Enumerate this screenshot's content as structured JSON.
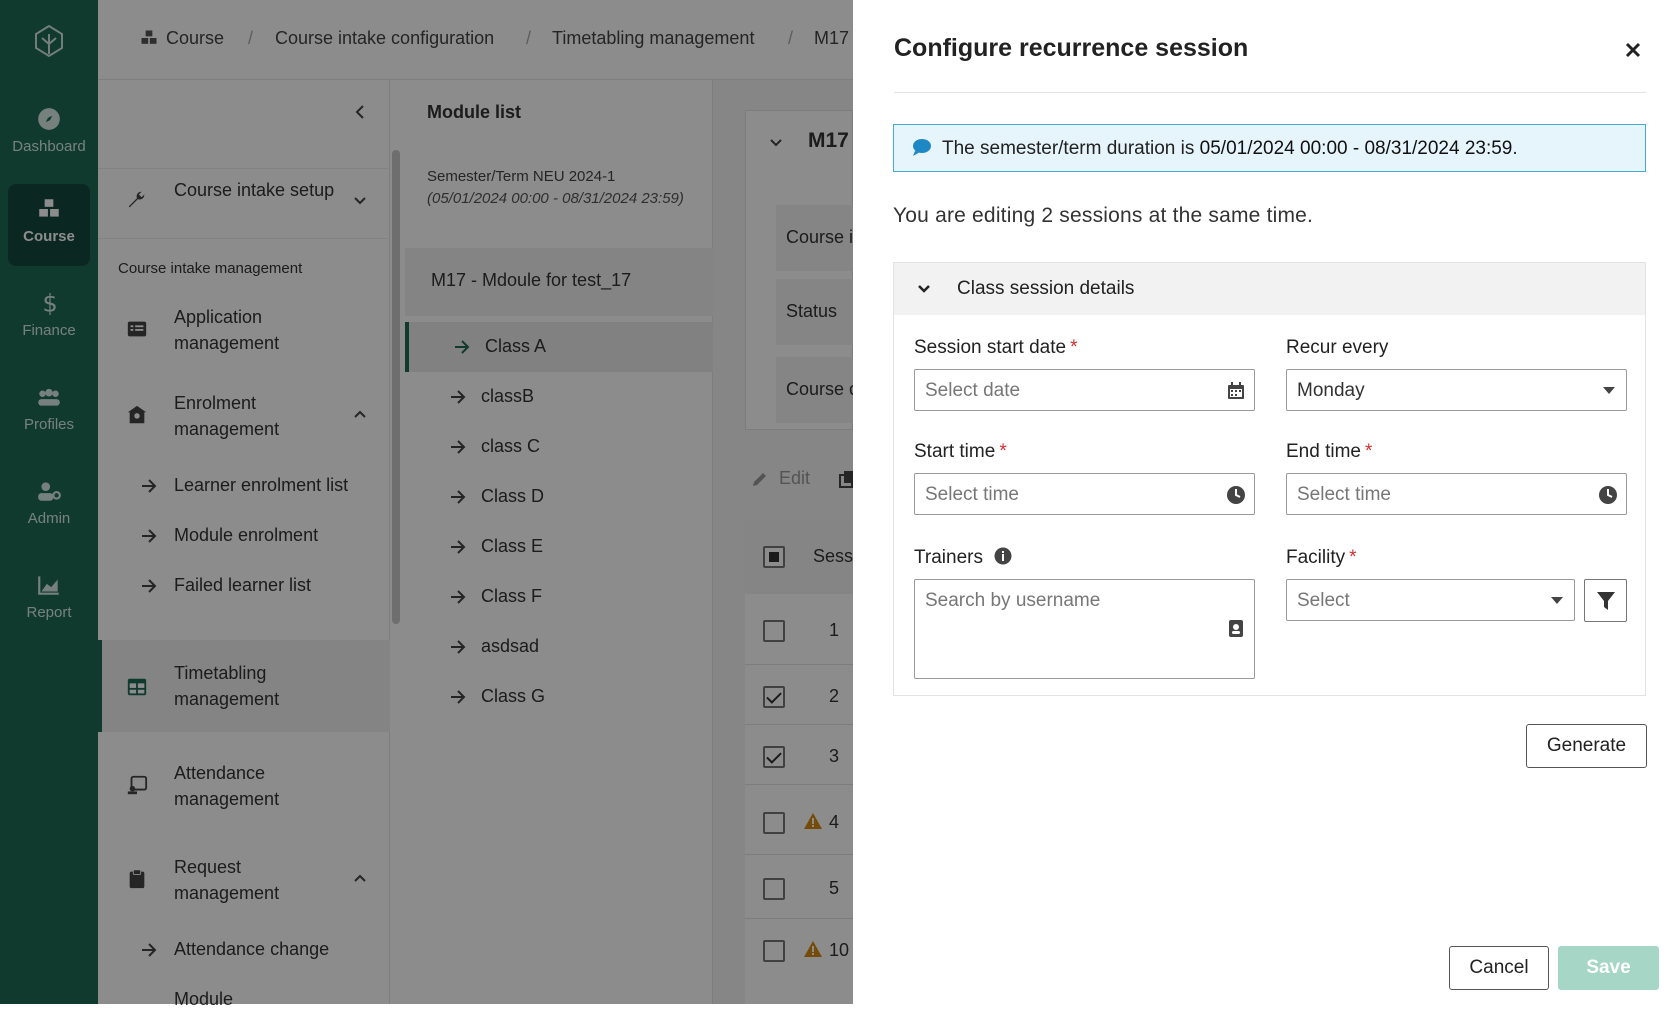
{
  "rail": {
    "items": [
      {
        "label": "Dashboard",
        "icon": "compass-icon"
      },
      {
        "label": "Course",
        "icon": "cubes-icon"
      },
      {
        "label": "Finance",
        "icon": "dollar-icon"
      },
      {
        "label": "Profiles",
        "icon": "users-icon"
      },
      {
        "label": "Admin",
        "icon": "user-gear-icon"
      },
      {
        "label": "Report",
        "icon": "chart-icon"
      }
    ]
  },
  "breadcrumb": [
    "Course",
    "Course intake configuration",
    "Timetabling management",
    "M17"
  ],
  "nav": {
    "setup": "Course intake setup",
    "section": "Course intake management",
    "application": "Application management",
    "enrolment": "Enrolment management",
    "sub_enrolment": [
      "Learner enrolment list",
      "Module enrolment",
      "Failed learner list"
    ],
    "timetabling": "Timetabling management",
    "attendance": "Attendance management",
    "request": "Request management",
    "sub_request": [
      "Attendance change",
      "Module"
    ]
  },
  "modlist": {
    "title": "Module list",
    "semester": "Semester/Term NEU 2024-1",
    "semester_range": "(05/01/2024 00:00 - 08/31/2024 23:59)",
    "module": "M17 - Mdoule for test_17",
    "classes": [
      "Class A",
      "classB",
      "class C",
      "Class D",
      "Class E",
      "Class F",
      "asdsad",
      "Class G"
    ]
  },
  "main": {
    "code": "M17",
    "rows": [
      "Course i",
      "Status",
      "Course c"
    ],
    "edit": "Edit",
    "col": "Sess",
    "nums": [
      "1",
      "2",
      "3",
      "4",
      "5",
      "10"
    ]
  },
  "drawer": {
    "title": "Configure recurrence session",
    "info_prefix": "The semester/term duration is ",
    "info_range": "05/01/2024 00:00 - 08/31/2024 23:59",
    "info_suffix": ".",
    "editing": "You are editing 2 sessions at the same time.",
    "panel_title": "Class session details",
    "start_date_label": "Session start date",
    "start_date_placeholder": "Select date",
    "recur_label": "Recur every",
    "recur_value": "Monday",
    "start_time_label": "Start time",
    "start_time_placeholder": "Select time",
    "end_time_label": "End time",
    "end_time_placeholder": "Select time",
    "trainers_label": "Trainers",
    "trainers_placeholder": "Search by username",
    "facility_label": "Facility",
    "facility_placeholder": "Select",
    "required_mark": "*",
    "generate": "Generate",
    "cancel": "Cancel",
    "save": "Save"
  },
  "colors": {
    "brand": "#1f6b57",
    "info_bg": "#e6f4fb",
    "info_border": "#4aa8d8",
    "required": "#d32f2f",
    "save_disabled": "#a6d6c5"
  }
}
